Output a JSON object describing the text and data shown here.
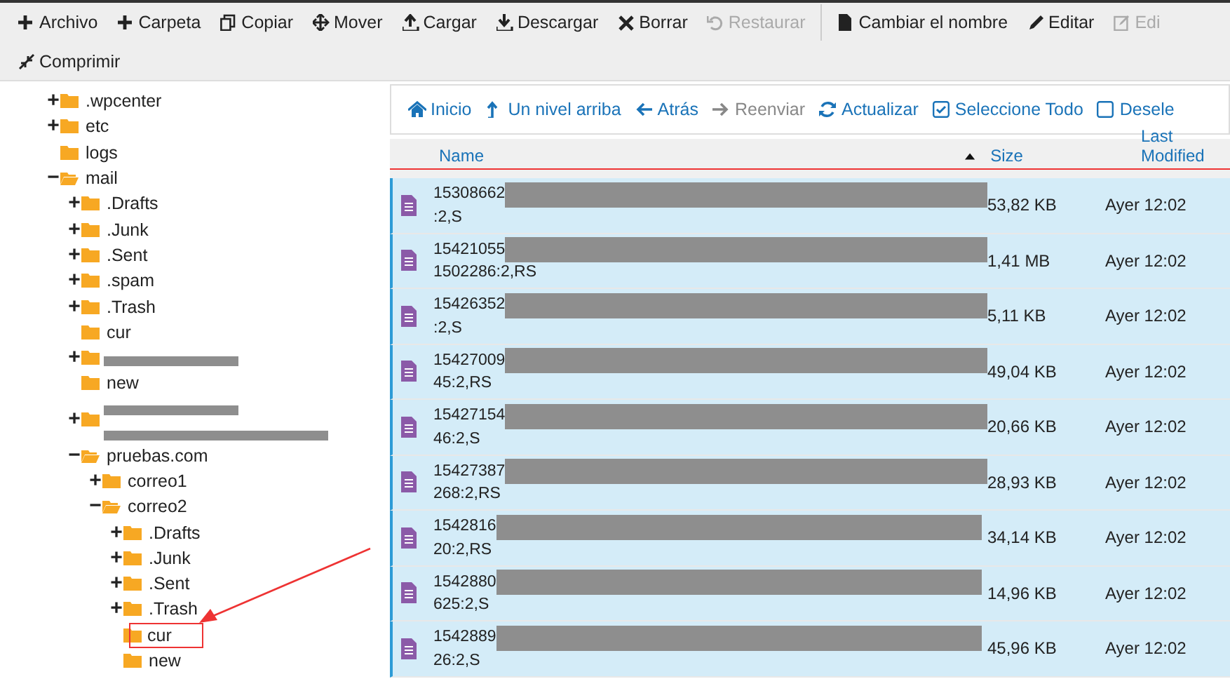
{
  "toolbar": {
    "rows": [
      [
        {
          "label": "Archivo",
          "disabled": false
        },
        {
          "label": "Carpeta",
          "disabled": false
        },
        {
          "label": "Copiar",
          "disabled": false
        },
        {
          "label": "Mover",
          "disabled": false
        },
        {
          "label": "Cargar",
          "disabled": false
        },
        {
          "label": "Descargar",
          "disabled": false
        },
        {
          "label": "Borrar",
          "disabled": false
        },
        {
          "label": "Restaurar",
          "disabled": true
        },
        {
          "label": "Cambiar el nombre",
          "disabled": false
        },
        {
          "label": "Editar",
          "disabled": false
        },
        {
          "label": "Edi",
          "disabled": true
        }
      ],
      [
        {
          "label": "Comprimir",
          "disabled": false
        }
      ]
    ]
  },
  "tree": [
    {
      "label": ".wpcenter",
      "kind": "folder",
      "toggle": "+"
    },
    {
      "label": "etc",
      "kind": "folder",
      "toggle": "+"
    },
    {
      "label": "logs",
      "kind": "folder"
    },
    {
      "label": "mail",
      "kind": "open_folder",
      "toggle": "−",
      "children": [
        {
          "label": ".Drafts",
          "kind": "folder",
          "toggle": "+"
        },
        {
          "label": ".Junk",
          "kind": "folder",
          "toggle": "+"
        },
        {
          "label": ".Sent",
          "kind": "folder",
          "toggle": "+"
        },
        {
          "label": ".spam",
          "kind": "folder",
          "toggle": "+"
        },
        {
          "label": ".Trash",
          "kind": "folder",
          "toggle": "+"
        },
        {
          "label": "cur",
          "kind": "folder"
        },
        {
          "kind": "redacted",
          "toggle": "+"
        },
        {
          "label": "new",
          "kind": "folder"
        },
        {
          "kind": "redacted_two_lines",
          "toggle": "+"
        },
        {
          "label": "pruebas.com",
          "kind": "open_folder",
          "toggle": "−",
          "children": [
            {
              "label": "correo1",
              "kind": "folder",
              "toggle": "+"
            },
            {
              "label": "correo2",
              "kind": "open_folder",
              "toggle": "−",
              "children": [
                {
                  "label": ".Drafts",
                  "kind": "folder",
                  "toggle": "+"
                },
                {
                  "label": ".Junk",
                  "kind": "folder",
                  "toggle": "+"
                },
                {
                  "label": ".Sent",
                  "kind": "folder",
                  "toggle": "+"
                },
                {
                  "label": ".Trash",
                  "kind": "folder",
                  "toggle": "+"
                },
                {
                  "label": "cur",
                  "kind": "marked"
                },
                {
                  "label": "new",
                  "kind": "folder"
                }
              ]
            }
          ]
        }
      ]
    }
  ],
  "nav": [
    {
      "label": "Inicio",
      "disabled": false
    },
    {
      "label": "Un nivel arriba",
      "disabled": false
    },
    {
      "label": "Atrás",
      "disabled": false
    },
    {
      "label": "Reenviar",
      "disabled": true
    },
    {
      "label": "Actualizar",
      "disabled": false
    },
    {
      "label": "Seleccione Todo",
      "disabled": false
    },
    {
      "label": "Desele",
      "disabled": false
    }
  ],
  "table": {
    "columns": [
      {
        "label": "Name",
        "sorted": true
      },
      {
        "label": "Size",
        "sorted": false
      },
      {
        "label": "Last Modified",
        "sorted": false
      }
    ],
    "outlined": true,
    "rows": [
      {
        "name_start": "15308662",
        "name_end": ":2,S",
        "size": "53,82 KB",
        "modified": "Ayer 12:02",
        "selected": true
      },
      {
        "name_start": "15421055",
        "name_end": "1502286:2,RS",
        "size": "1,41 MB",
        "modified": "Ayer 12:02",
        "selected": true
      },
      {
        "name_start": "15426352",
        "name_end": ":2,S",
        "size": "5,11 KB",
        "modified": "Ayer 12:02",
        "selected": true
      },
      {
        "name_start": "15427009",
        "name_end": "45:2,RS",
        "size": "49,04 KB",
        "modified": "Ayer 12:02",
        "selected": true
      },
      {
        "name_start": "15427154",
        "name_end": "46:2,S",
        "size": "20,66 KB",
        "modified": "Ayer 12:02",
        "selected": true
      },
      {
        "name_start": "15427387",
        "name_end": "268:2,RS",
        "size": "28,93 KB",
        "modified": "Ayer 12:02",
        "selected": true
      },
      {
        "name_start": "1542816",
        "name_end": "20:2,RS",
        "size": "34,14 KB",
        "modified": "Ayer 12:02",
        "selected": true
      },
      {
        "name_start": "1542880",
        "name_end": "625:2,S",
        "size": "14,96 KB",
        "modified": "Ayer 12:02",
        "selected": true
      },
      {
        "name_start": "1542889",
        "name_end": "26:2,S",
        "size": "45,96 KB",
        "modified": "Ayer 12:02",
        "selected": true
      }
    ]
  },
  "annotation_arrow": true
}
